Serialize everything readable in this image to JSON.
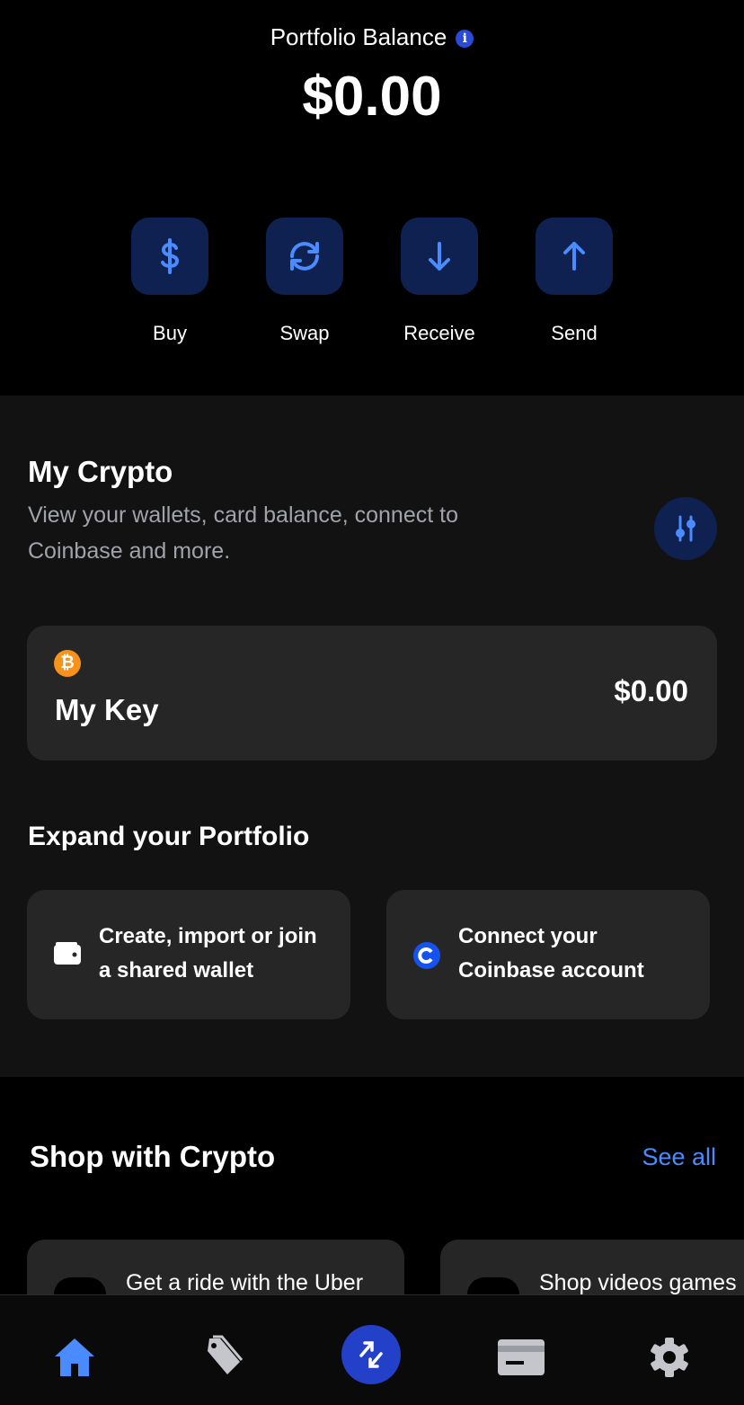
{
  "header": {
    "title": "Portfolio Balance",
    "balance": "$0.00"
  },
  "actions": [
    {
      "label": "Buy",
      "icon": "dollar-icon"
    },
    {
      "label": "Swap",
      "icon": "swap-icon"
    },
    {
      "label": "Receive",
      "icon": "arrow-down-icon"
    },
    {
      "label": "Send",
      "icon": "arrow-up-icon"
    }
  ],
  "my_crypto": {
    "title": "My Crypto",
    "subtitle_line1": "View your wallets, card balance, connect to",
    "subtitle_line2": "Coinbase and more.",
    "wallet": {
      "name": "My Key",
      "balance": "$0.00",
      "icon": "bitcoin-icon"
    }
  },
  "expand": {
    "title": "Expand your Portfolio",
    "cards": [
      {
        "line1": "Create, import or join",
        "line2": "a shared wallet",
        "icon": "wallet-icon"
      },
      {
        "line1": "Connect your",
        "line2": "Coinbase account",
        "icon": "coinbase-icon"
      }
    ]
  },
  "shop": {
    "title": "Shop with Crypto",
    "see_all": "See all",
    "cards": [
      {
        "text": "Get a ride with the Uber"
      },
      {
        "text": "Shop videos games"
      }
    ]
  },
  "nav": [
    "home-icon",
    "tags-icon",
    "trade-icon",
    "card-icon",
    "settings-icon"
  ],
  "colors": {
    "accent": "#4a8cff",
    "action_bg": "#0e2150",
    "nav_active": "#2340c8"
  }
}
